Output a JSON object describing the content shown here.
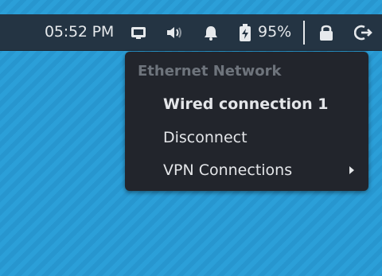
{
  "top_panel": {
    "clock": "05:52 PM",
    "battery_percent_text": "95%",
    "icons": [
      "screen-icon",
      "volume-icon",
      "notification-bell-icon",
      "battery-charging-icon",
      "lock-icon",
      "logout-icon"
    ]
  },
  "network_menu": {
    "header": "Ethernet Network",
    "items": [
      {
        "label": "Wired connection 1",
        "bold": true
      },
      {
        "label": "Disconnect"
      },
      {
        "label": "VPN Connections",
        "has_submenu": true
      }
    ]
  },
  "colors": {
    "panel_bg": "#243443",
    "menu_bg": "#22252c",
    "desktop_bg": "#2b9fd8",
    "menu_text": "#e4e6e9",
    "header_text": "#6e747c"
  }
}
